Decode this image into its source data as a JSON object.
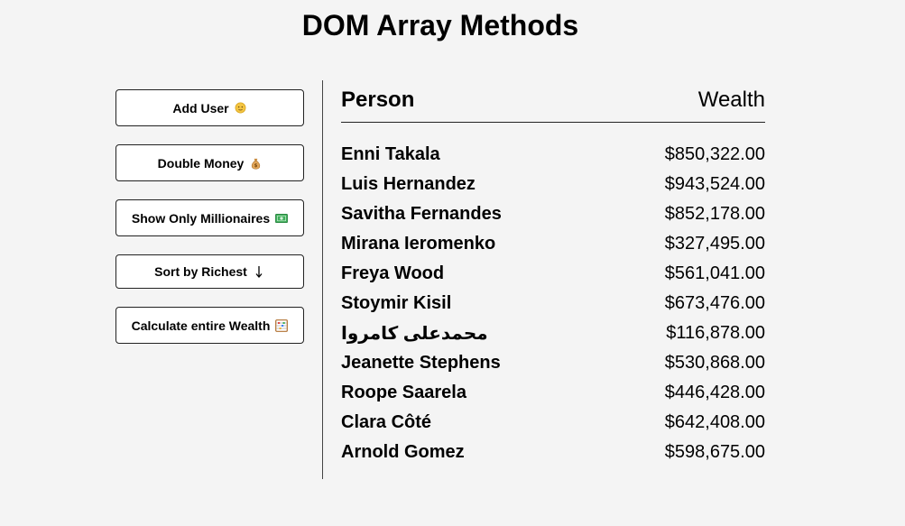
{
  "page": {
    "title": "DOM Array Methods"
  },
  "buttons": [
    {
      "label": "Add User",
      "icon": "person-emoji-icon"
    },
    {
      "label": "Double Money",
      "icon": "money-bag-icon"
    },
    {
      "label": "Show Only Millionaires",
      "icon": "dollar-banknote-icon"
    },
    {
      "label": "Sort by Richest",
      "icon": "down-arrow-icon"
    },
    {
      "label": "Calculate entire Wealth",
      "icon": "abacus-icon"
    }
  ],
  "table": {
    "header_person": "Person",
    "header_wealth": "Wealth",
    "rows": [
      {
        "name": "Enni Takala",
        "wealth": "$850,322.00"
      },
      {
        "name": "Luis Hernandez",
        "wealth": "$943,524.00"
      },
      {
        "name": "Savitha Fernandes",
        "wealth": "$852,178.00"
      },
      {
        "name": "Mirana Ieromenko",
        "wealth": "$327,495.00"
      },
      {
        "name": "Freya Wood",
        "wealth": "$561,041.00"
      },
      {
        "name": "Stoymir Kisil",
        "wealth": "$673,476.00"
      },
      {
        "name": "محمدعلی کامروا",
        "wealth": "$116,878.00"
      },
      {
        "name": "Jeanette Stephens",
        "wealth": "$530,868.00"
      },
      {
        "name": "Roope Saarela",
        "wealth": "$446,428.00"
      },
      {
        "name": "Clara Côté",
        "wealth": "$642,408.00"
      },
      {
        "name": "Arnold Gomez",
        "wealth": "$598,675.00"
      }
    ]
  }
}
